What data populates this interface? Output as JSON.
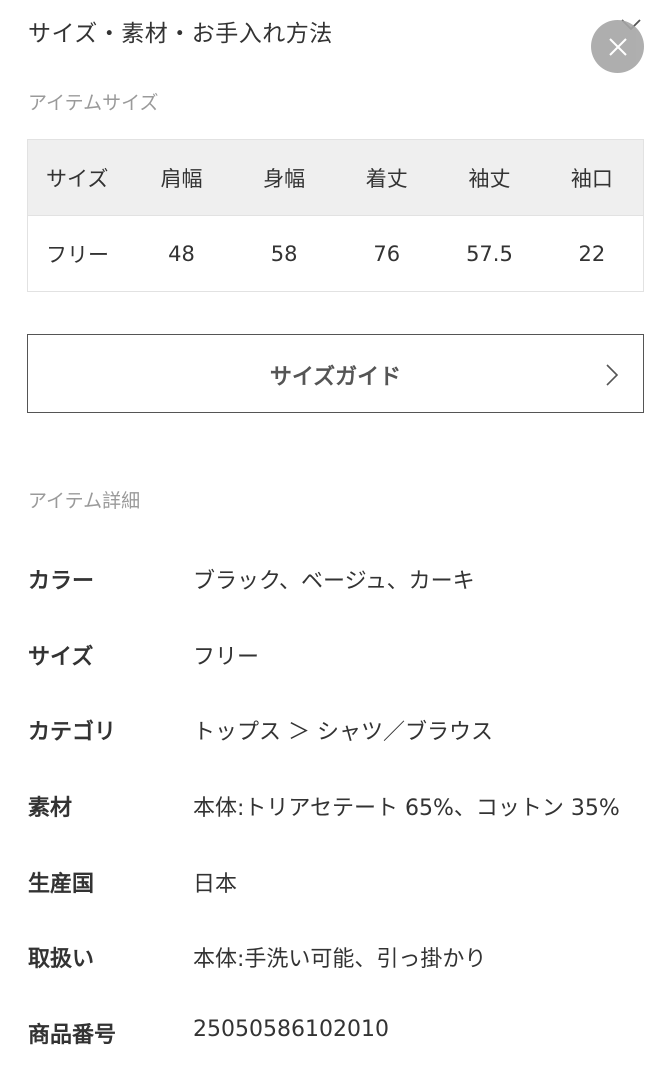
{
  "header": {
    "title": "サイズ・素材・お手入れ方法"
  },
  "size_section": {
    "label": "アイテムサイズ",
    "columns": [
      "サイズ",
      "肩幅",
      "身幅",
      "着丈",
      "袖丈",
      "袖口"
    ],
    "rows": [
      [
        "フリー",
        "48",
        "58",
        "76",
        "57.5",
        "22"
      ]
    ]
  },
  "size_guide": {
    "label": "サイズガイド"
  },
  "detail_section": {
    "label": "アイテム詳細",
    "rows": [
      {
        "key": "カラー",
        "value": "ブラック、ベージュ、カーキ"
      },
      {
        "key": "サイズ",
        "value": "フリー"
      },
      {
        "key": "カテゴリ",
        "value": "トップス ＞ シャツ／ブラウス"
      },
      {
        "key": "素材",
        "value": "本体:トリアセテート 65%、コットン 35%"
      },
      {
        "key": "生産国",
        "value": "日本"
      },
      {
        "key": "取扱い",
        "value": "本体:手洗い可能、引っ掛かり"
      },
      {
        "key": "商品番号",
        "value": "25050586102010"
      }
    ]
  },
  "icons": {
    "close": "close-icon",
    "chevron_down": "chevron-down-icon",
    "chevron_right": "chevron-right-icon"
  }
}
